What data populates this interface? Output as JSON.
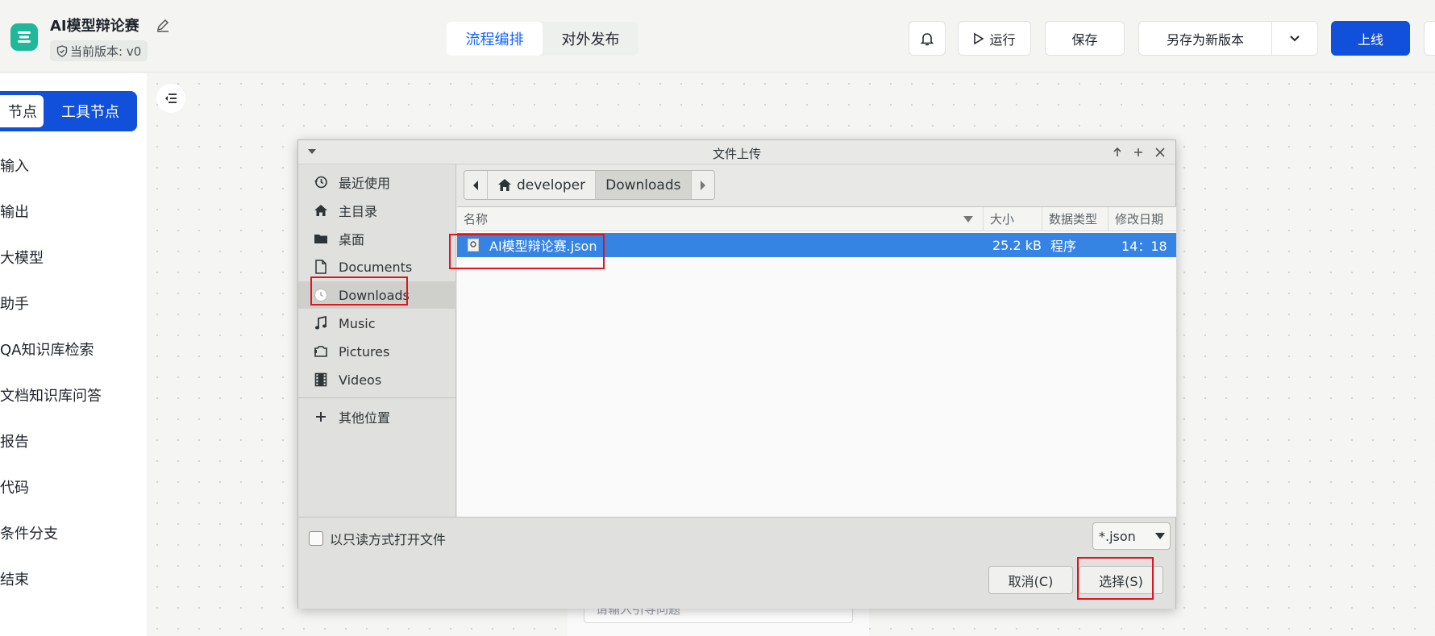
{
  "header": {
    "app_title": "AI模型辩论赛",
    "version": "当前版本: v0",
    "mode_tabs": [
      "流程编排",
      "对外发布"
    ],
    "run_label": "运行",
    "save_label": "保存",
    "save_as_label": "另存为新版本",
    "online_label": "上线"
  },
  "left_panel": {
    "tab_partial": "节点",
    "tab_tool": "工具节点",
    "items": [
      "输入",
      "输出",
      "大模型",
      "助手",
      "QA知识库检索",
      "文档知识库问答",
      "报告",
      "代码",
      "条件分支",
      "结束"
    ]
  },
  "background_input_placeholder": "请输入引导问题",
  "dialog": {
    "title": "文件上传",
    "places": [
      "最近使用",
      "主目录",
      "桌面",
      "Documents",
      "Downloads",
      "Music",
      "Pictures",
      "Videos"
    ],
    "other_locations": "其他位置",
    "path": [
      "developer",
      "Downloads"
    ],
    "columns": {
      "name": "名称",
      "size": "大小",
      "type": "数据类型",
      "modified": "修改日期"
    },
    "files": [
      {
        "name": "AI模型辩论赛.json",
        "size": "25.2 kB",
        "type": "程序",
        "modified": "14：18"
      }
    ],
    "readonly_label": "以只读方式打开文件",
    "filter": "*.json",
    "cancel_label": "取消(C)",
    "select_label": "选择(S)"
  },
  "colors": {
    "primary": "#1150db",
    "selection": "#3584e4",
    "highlight": "#e0141e",
    "logo": "#1fb89a"
  }
}
